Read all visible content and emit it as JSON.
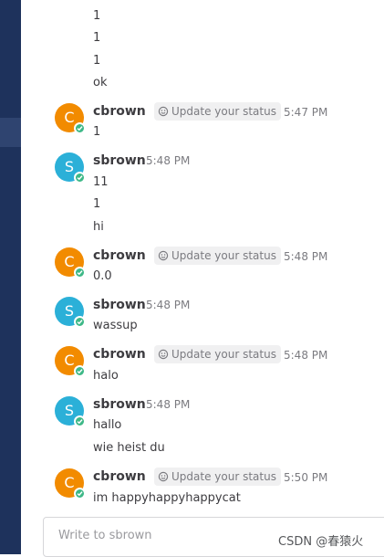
{
  "colors": {
    "sidebar": "#1e325c",
    "cbrown_avatar": "#f28b00",
    "sbrown_avatar": "#2bb0d8",
    "online": "#3db887"
  },
  "feed": {
    "head_lines": [
      "1",
      "1",
      "1",
      "ok"
    ],
    "posts": [
      {
        "user": "cbrown",
        "initial": "C",
        "status": "Update your status",
        "time": "5:47 PM",
        "lines": [
          "1"
        ]
      },
      {
        "user": "sbrown",
        "initial": "S",
        "time": "5:48 PM",
        "lines": [
          "11",
          "1",
          "hi"
        ]
      },
      {
        "user": "cbrown",
        "initial": "C",
        "status": "Update your status",
        "time": "5:48 PM",
        "lines": [
          "0.0"
        ]
      },
      {
        "user": "sbrown",
        "initial": "S",
        "time": "5:48 PM",
        "lines": [
          "wassup"
        ]
      },
      {
        "user": "cbrown",
        "initial": "C",
        "status": "Update your status",
        "time": "5:48 PM",
        "lines": [
          "halo"
        ]
      },
      {
        "user": "sbrown",
        "initial": "S",
        "time": "5:48 PM",
        "lines": [
          "hallo",
          "wie heist du"
        ]
      },
      {
        "user": "cbrown",
        "initial": "C",
        "status": "Update your status",
        "time": "5:50 PM",
        "lines": [
          "im happyhappyhappycat"
        ]
      }
    ]
  },
  "composer": {
    "placeholder": "Write to sbrown",
    "value": ""
  },
  "watermark": "CSDN @春猿火"
}
